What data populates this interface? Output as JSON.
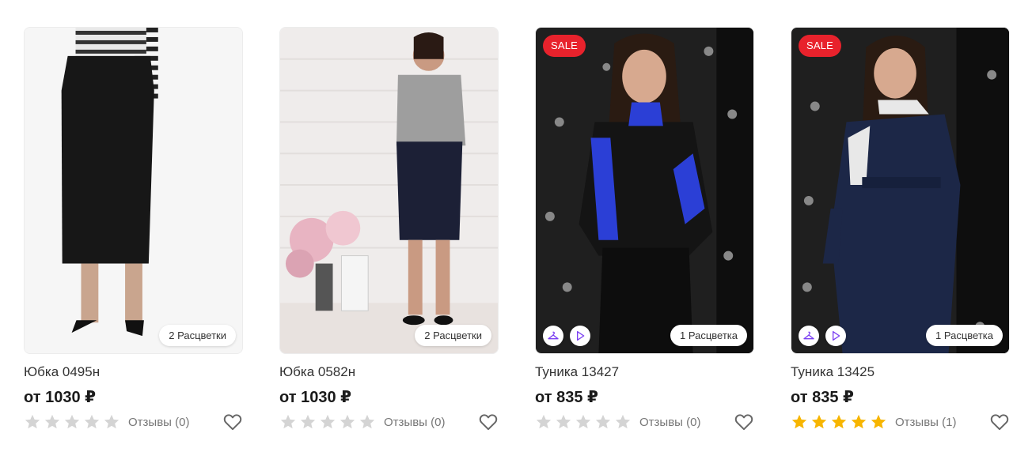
{
  "products": [
    {
      "name": "Юбка 0495н",
      "price": "от 1030 ₽",
      "colors_label": "2 Расцветки",
      "sale_label": "",
      "rating": 0,
      "reviews_label": "Отзывы (0)",
      "icons": [],
      "colors": {
        "bg": "#f2f2f2",
        "top": "#2a2a2a",
        "bottom": "#141414"
      }
    },
    {
      "name": "Юбка 0582н",
      "price": "от 1030 ₽",
      "colors_label": "2 Расцветки",
      "sale_label": "",
      "rating": 0,
      "reviews_label": "Отзывы (0)",
      "icons": [],
      "colors": {
        "bg": "#ece9e6",
        "top": "#9a9a9a",
        "bottom": "#1c2036"
      }
    },
    {
      "name": "Туника 13427",
      "price": "от 835 ₽",
      "colors_label": "1 Расцветка",
      "sale_label": "SALE",
      "rating": 0,
      "reviews_label": "Отзывы (0)",
      "icons": [
        "hanger-icon",
        "play-icon"
      ],
      "colors": {
        "bg": "#232323",
        "top": "#121212",
        "bottom": "#121212",
        "accent": "#2b3fd6"
      }
    },
    {
      "name": "Туника 13425",
      "price": "от 835 ₽",
      "colors_label": "1 Расцветка",
      "sale_label": "SALE",
      "rating": 5,
      "reviews_label": "Отзывы (1)",
      "icons": [
        "hanger-icon",
        "play-icon"
      ],
      "colors": {
        "bg": "#232323",
        "top": "#1c2747",
        "bottom": "#1c2747",
        "accent": "#e8e8e8"
      }
    }
  ],
  "theme": {
    "sale_color": "#e8222c",
    "star_filled": "#f7b500",
    "star_empty": "#d4d4d4",
    "icon_accent": "#7b3ff2"
  }
}
